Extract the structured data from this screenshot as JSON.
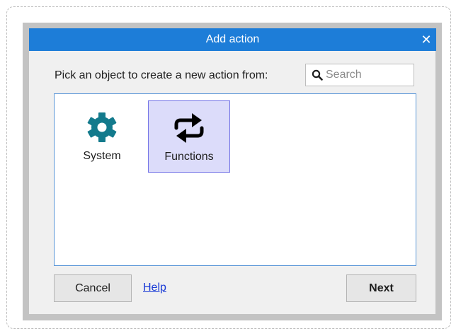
{
  "dialog": {
    "title": "Add action",
    "close_glyph": "✕",
    "prompt": "Pick an object to create a new action from:",
    "search": {
      "placeholder": "Search",
      "value": ""
    },
    "objects": [
      {
        "label": "System",
        "icon": "gear-icon",
        "selected": false
      },
      {
        "label": "Functions",
        "icon": "swap-arrows-icon",
        "selected": true
      }
    ],
    "buttons": {
      "cancel_label": "Cancel",
      "help_label": "Help",
      "next_label": "Next"
    }
  },
  "colors": {
    "titlebar": "#1d7dd8",
    "gear_icon": "#137a8c",
    "selection_fill": "#dcdcfa",
    "selection_border": "#7373e6",
    "link": "#1a3bd6"
  }
}
